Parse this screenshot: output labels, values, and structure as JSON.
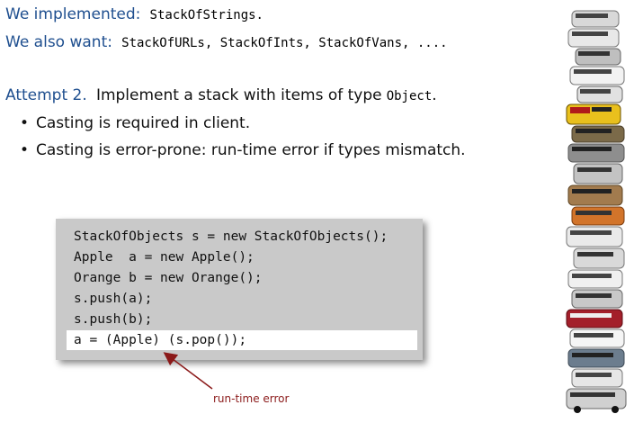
{
  "header": {
    "implemented_label": "We implemented:",
    "implemented_code": "StackOfStrings.",
    "want_label": "We also want:",
    "want_code": "StackOfURLs, StackOfInts, StackOfVans, ...."
  },
  "attempt": {
    "label": "Attempt 2.",
    "text": "Implement a stack with items of type",
    "code": "Object",
    "period": "."
  },
  "bullets": [
    "Casting is required in client.",
    "Casting is error-prone:  run-time error if types mismatch."
  ],
  "code_lines": [
    "StackOfObjects s = new StackOfObjects();",
    "Apple  a = new Apple();",
    "Orange b = new Orange();",
    "s.push(a);",
    "s.push(b);",
    "a = (Apple) (s.pop());"
  ],
  "error_label": "run-time error",
  "colors": {
    "heading_blue": "#1f4f8f",
    "code_box": "#c9c9c9",
    "error_red": "#8b1a1a"
  },
  "image": {
    "description_icon": "stacked-vans-image"
  }
}
